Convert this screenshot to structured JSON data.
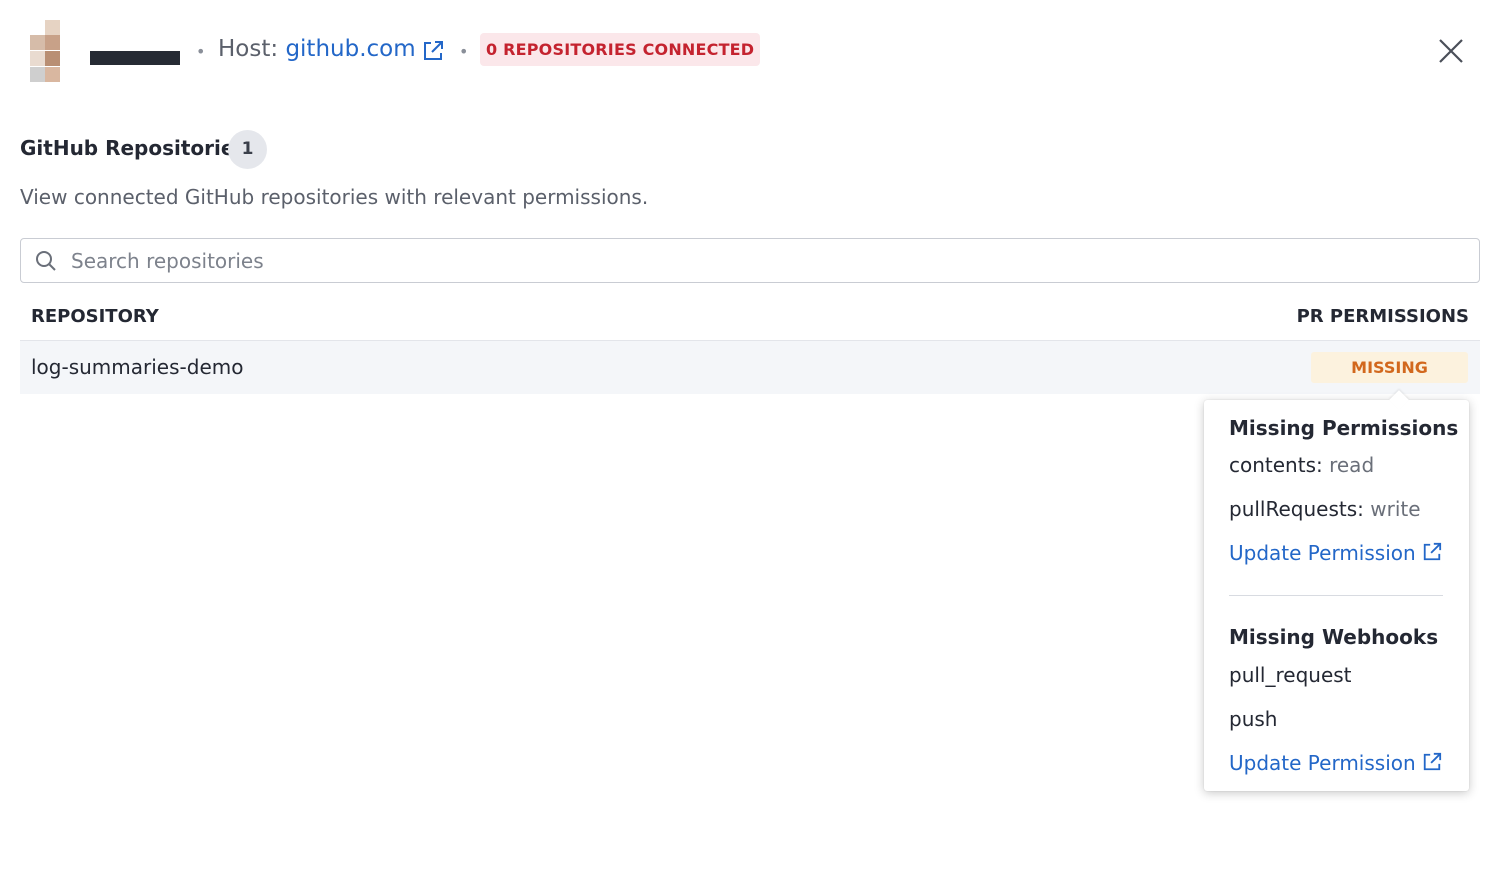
{
  "header": {
    "host_label": "Host:",
    "host_link": "github.com",
    "status_badge": "0 REPOSITORIES CONNECTED",
    "separator": "•"
  },
  "section": {
    "title": "GitHub Repositories",
    "count": "1",
    "description": "View connected GitHub repositories with relevant permissions."
  },
  "search": {
    "placeholder": "Search repositories"
  },
  "table": {
    "columns": [
      "REPOSITORY",
      "PR PERMISSIONS"
    ],
    "rows": [
      {
        "repository": "log-summaries-demo",
        "pr_permissions": "MISSING"
      }
    ]
  },
  "popover": {
    "permissions_title": "Missing Permissions",
    "permissions": [
      {
        "name": "contents:",
        "value": "read"
      },
      {
        "name": "pullRequests:",
        "value": "write"
      }
    ],
    "permissions_link": "Update Permission",
    "webhooks_title": "Missing Webhooks",
    "webhooks": [
      "pull_request",
      "push"
    ],
    "webhooks_link": "Update Permission"
  },
  "colors": {
    "link": "#2367c8",
    "error_badge_bg": "#fbe7ea",
    "error_badge_text": "#c4232f",
    "warning_badge_bg": "#fcf2de",
    "warning_badge_text": "#d2681d"
  },
  "icons": [
    "external-link-icon",
    "close-icon",
    "search-icon"
  ]
}
